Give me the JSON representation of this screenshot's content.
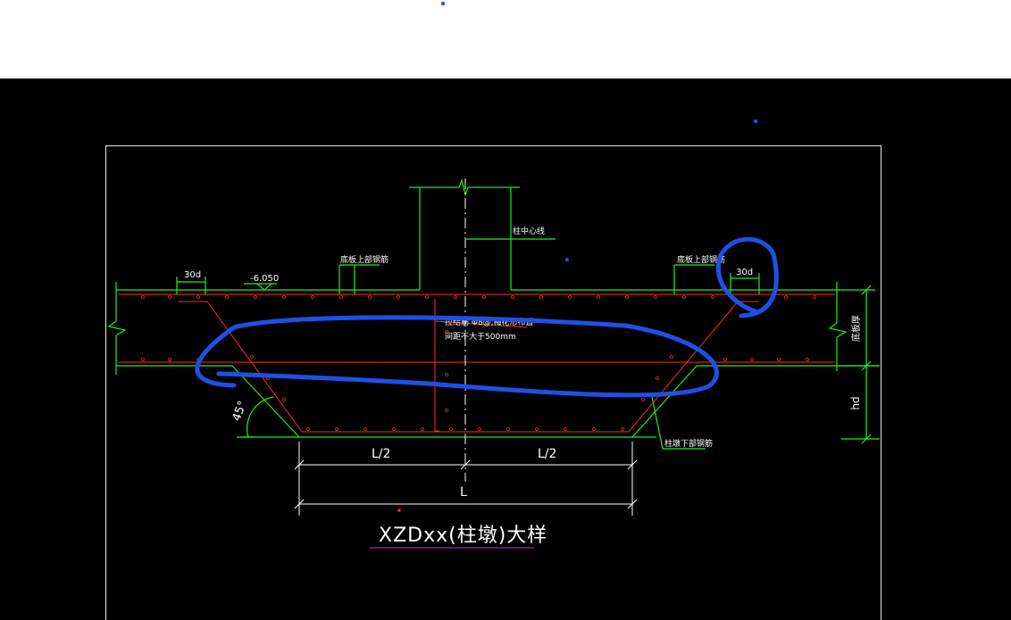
{
  "drawing": {
    "title": "XZDxx(柱墩)大样",
    "labels": {
      "dim_30d_left": "30d",
      "dim_30d_right": "30d",
      "elevation": "-6.050",
      "top_rebar_left": "底板上部钢筋",
      "top_rebar_right": "底板上部钢筋",
      "column_centerline": "柱中心线",
      "note_line1": "拉结筋 Φ8@,梅花形布置",
      "note_line2": "间距不大于500mm",
      "bottom_rebar": "柱墩下部钢筋",
      "slab_thickness": "底板厚",
      "depth": "hd",
      "angle": "45°",
      "half_left": "L/2",
      "half_right": "L/2",
      "total": "L"
    }
  },
  "colors": {
    "screen_bg": "#000000",
    "outer_bg": "#ffffff",
    "concrete": "#22ee22",
    "rebar": "#ff2a2a",
    "dimension": "#ffffff",
    "border": "#e8e8e8",
    "title_underline": "#cc33cc",
    "label_text": "#ffffff",
    "annotation": "#1e50e6"
  }
}
